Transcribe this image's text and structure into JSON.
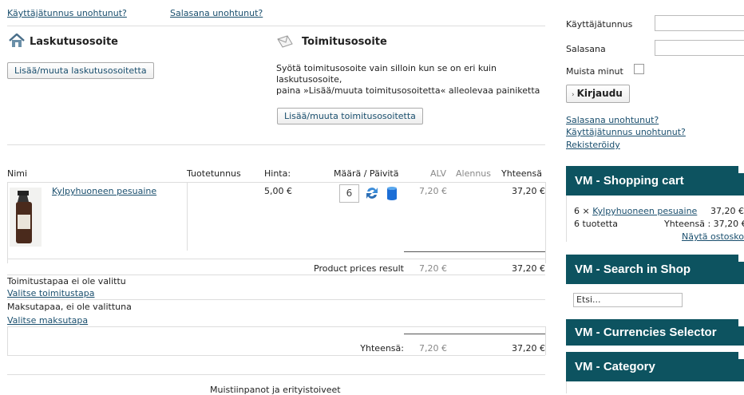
{
  "top_links": {
    "forgot_username": "Käyttäjätunnus unohtunut?",
    "forgot_password": "Salasana unohtunut?"
  },
  "billing": {
    "title": "Laskutusosoite",
    "button": "Lisää/muuta laskutusosoitetta"
  },
  "shipping": {
    "title": "Toimitusosoite",
    "line1": "Syötä toimitusosoite vain silloin kun se on eri kuin",
    "line2": "laskutusosoite,",
    "line3": "paina »Lisää/muuta toimitusosoitetta« alleolevaa painiketta",
    "button": "Lisää/muuta toimitusosoitetta"
  },
  "cart_table": {
    "headers": {
      "name": "Nimi",
      "sku": "Tuotetunnus",
      "price": "Hinta:",
      "qty": "Määrä / Päivitä",
      "vat": "ALV",
      "discount": "Alennus",
      "total": "Yhteensä"
    },
    "item": {
      "name": "Kylpyhuoneen pesuaine",
      "price": "5,00 €",
      "qty": "6",
      "vat": "7,20 €",
      "total": "37,20 €"
    },
    "prices_result": {
      "label": "Product prices result",
      "vat": "7,20 €",
      "total": "37,20 €"
    },
    "shipping_method": {
      "status": "Toimitustapaa ei ole valittu",
      "link": "Valitse toimitustapa"
    },
    "payment_method": {
      "status": "Maksutapaa, ei ole valittuna",
      "link": "Valitse maksutapa"
    },
    "grand_total": {
      "label": "Yhteensä:",
      "vat": "7,20 €",
      "total": "37,20 €"
    }
  },
  "notes_label": "Muistiinpanot ja erityistoiveet",
  "login": {
    "username_label": "Käyttäjätunnus",
    "password_label": "Salasana",
    "remember_label": "Muista minut",
    "login_button": "Kirjaudu",
    "forgot_password": "Salasana unohtunut?",
    "forgot_username": "Käyttäjätunnus unohtunut?",
    "register": "Rekisteröidy"
  },
  "modules": {
    "cart": {
      "title": "VM - Shopping cart",
      "qty_prefix": "6 ×",
      "item_name": "Kylpyhuoneen pesuaine",
      "item_price": "37,20 €",
      "count": "6 tuotetta",
      "total": "Yhteensä : 37,20 €",
      "show_cart": "Näytä ostoskori"
    },
    "search": {
      "title": "VM - Search in Shop",
      "placeholder": "Etsi..."
    },
    "currencies": {
      "title": "VM - Currencies Selector"
    },
    "category": {
      "title": "VM - Category"
    }
  },
  "colors": {
    "module_bg": "#0d5360",
    "link": "#1a4f6e"
  }
}
